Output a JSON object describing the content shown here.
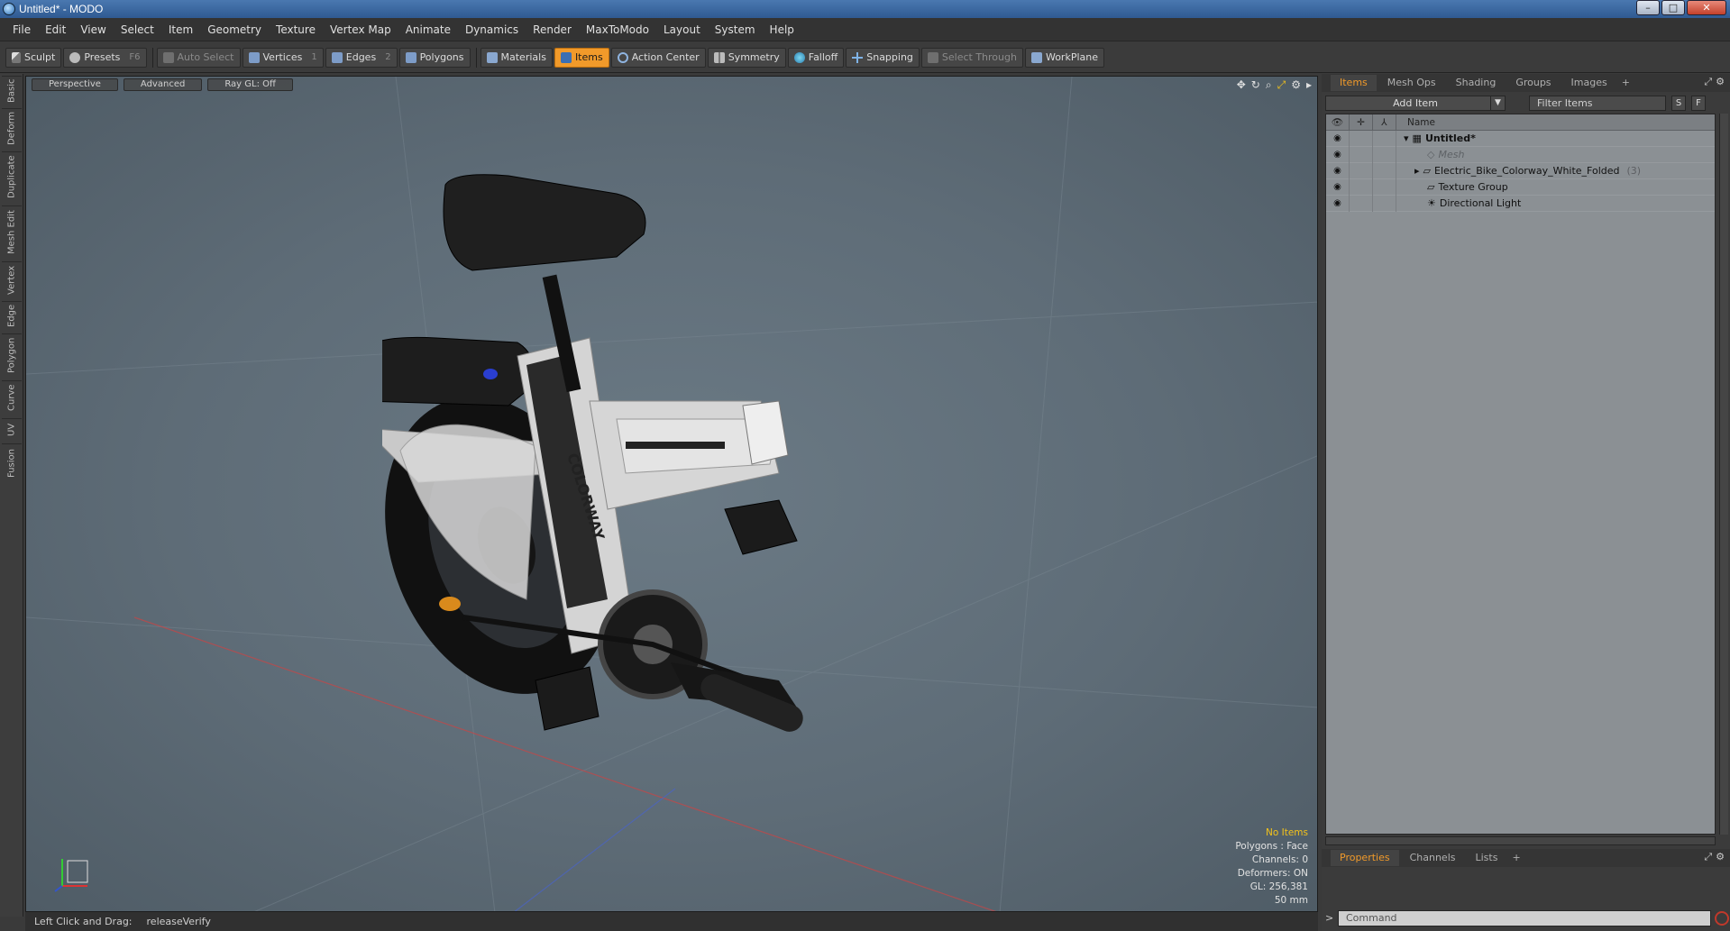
{
  "window": {
    "title": "Untitled* - MODO",
    "controls": [
      "–",
      "□",
      "✕"
    ]
  },
  "menu": [
    "File",
    "Edit",
    "View",
    "Select",
    "Item",
    "Geometry",
    "Texture",
    "Vertex Map",
    "Animate",
    "Dynamics",
    "Render",
    "MaxToModo",
    "Layout",
    "System",
    "Help"
  ],
  "toolbar": {
    "sculpt": "Sculpt",
    "presets": "Presets",
    "presets_key": "F6",
    "auto_select": "Auto Select",
    "vertices": "Vertices",
    "vertices_key": "1",
    "edges": "Edges",
    "edges_key": "2",
    "polygons": "Polygons",
    "materials": "Materials",
    "items": "Items",
    "action_center": "Action Center",
    "symmetry": "Symmetry",
    "falloff": "Falloff",
    "snapping": "Snapping",
    "select_through": "Select Through",
    "workplane": "WorkPlane"
  },
  "left_tabs": [
    "Basic",
    "Deform",
    "Duplicate",
    "Mesh Edit",
    "Vertex",
    "Edge",
    "Polygon",
    "Curve",
    "UV",
    "Fusion"
  ],
  "viewport": {
    "tabs": [
      "Perspective",
      "Advanced",
      "Ray GL: Off"
    ],
    "readout": {
      "selection": "No Items",
      "polygons": "Polygons : Face",
      "channels": "Channels: 0",
      "deformers": "Deformers: ON",
      "gl": "GL: 256,381",
      "scale": "50 mm"
    },
    "brand_text": "COLORWAY"
  },
  "status": {
    "hint": "Left Click and Drag:",
    "action": "releaseVerify"
  },
  "right_panel": {
    "tabs": [
      "Items",
      "Mesh Ops",
      "Shading",
      "Groups",
      "Images",
      "+"
    ],
    "add_item": "Add Item",
    "filter": "Filter Items",
    "s_btn": "S",
    "f_btn": "F",
    "name_header": "Name",
    "tree": [
      {
        "label": "Untitled*",
        "count": ""
      },
      {
        "label": "Mesh",
        "count": ""
      },
      {
        "label": "Electric_Bike_Colorway_White_Folded",
        "count": "(3)"
      },
      {
        "label": "Texture Group",
        "count": ""
      },
      {
        "label": "Directional Light",
        "count": ""
      }
    ],
    "bottom_tabs": [
      "Properties",
      "Channels",
      "Lists",
      "+"
    ],
    "command_placeholder": "Command"
  },
  "colors": {
    "accent": "#f19a2a",
    "readout_accent": "#f3c21b",
    "viewport_bg": "#5e6c77"
  }
}
